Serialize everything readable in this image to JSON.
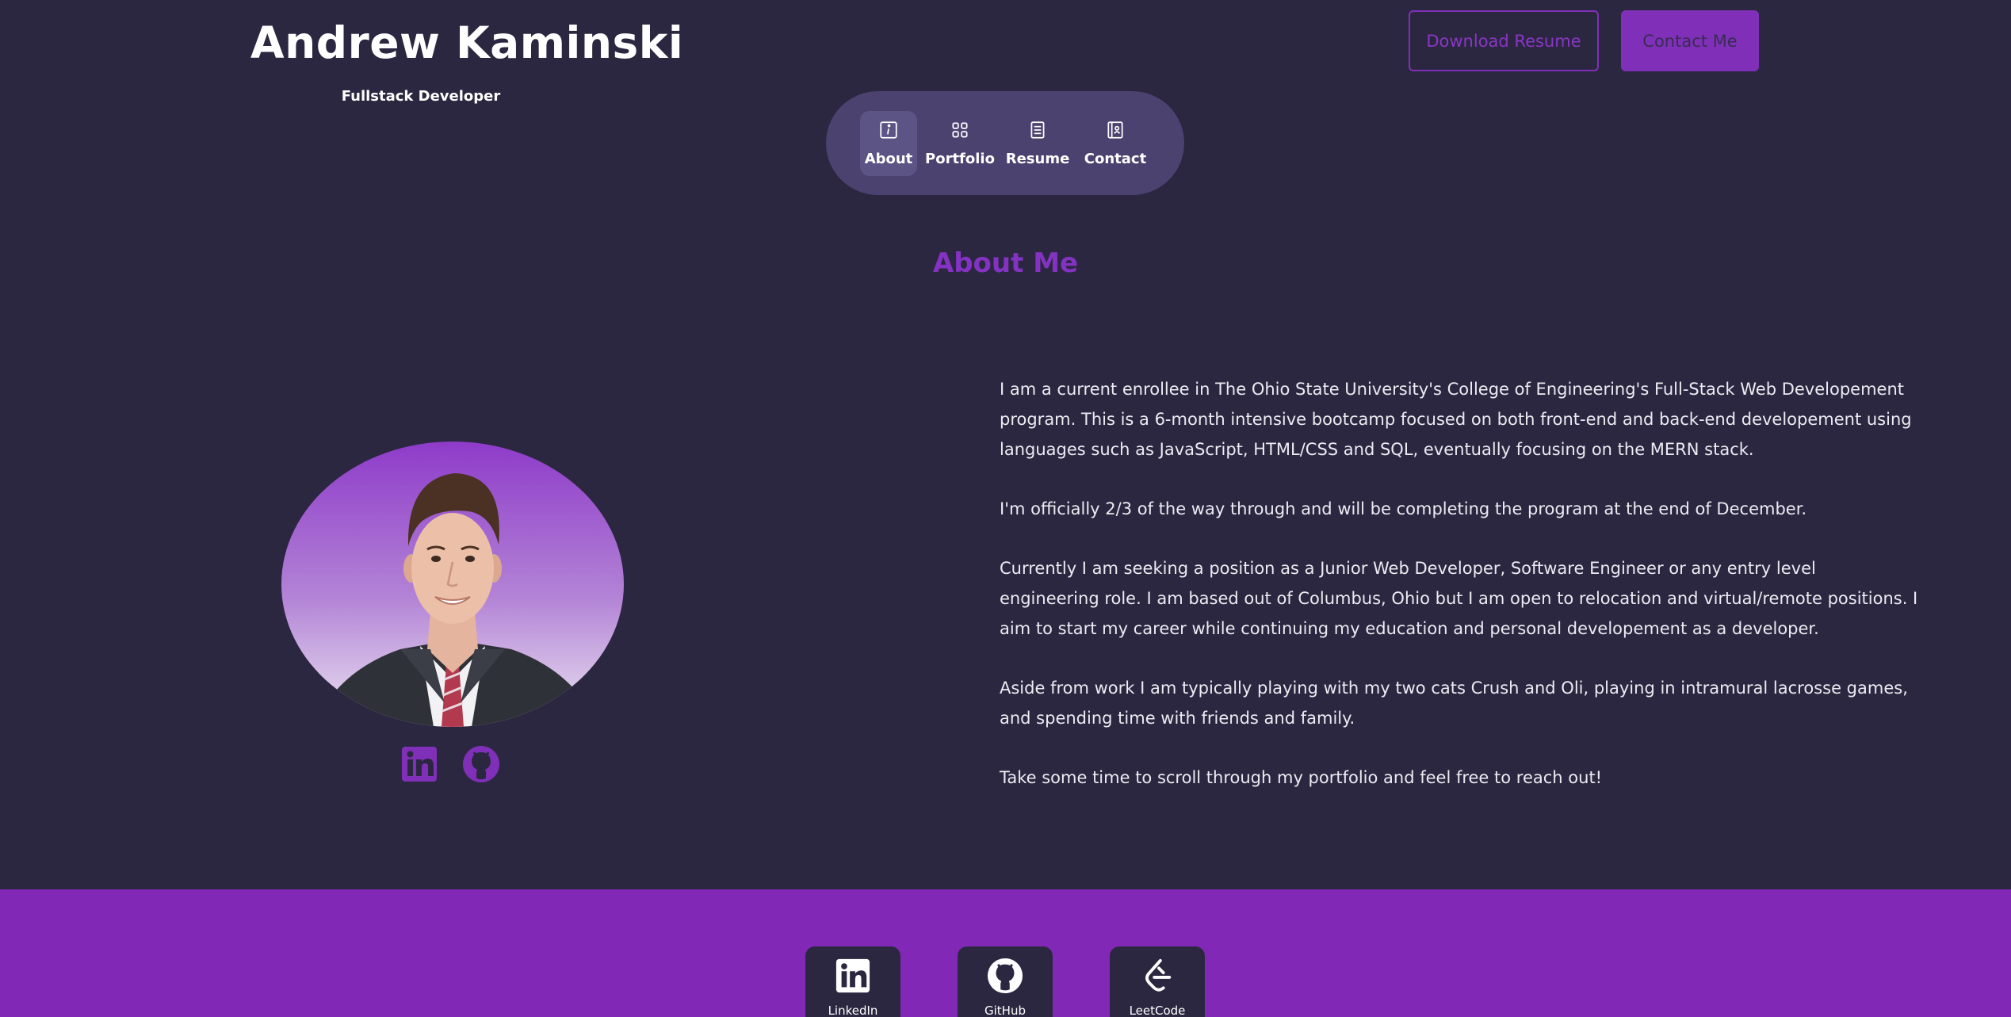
{
  "header": {
    "name": "Andrew Kaminski",
    "role": "Fullstack Developer",
    "download_resume": "Download Resume",
    "contact_me": "Contact Me"
  },
  "nav": {
    "items": [
      {
        "label": "About",
        "icon": "info-icon",
        "active": true
      },
      {
        "label": "Portfolio",
        "icon": "grid-icon",
        "active": false
      },
      {
        "label": "Resume",
        "icon": "document-icon",
        "active": false
      },
      {
        "label": "Contact",
        "icon": "contact-book-icon",
        "active": false
      }
    ]
  },
  "about": {
    "title": "About Me",
    "paragraphs": [
      "I am a current enrollee in The Ohio State University's College of Engineering's Full-Stack Web Developement program. This is a 6-month intensive bootcamp focused on both front-end and back-end developement using languages such as JavaScript, HTML/CSS and SQL, eventually focusing on the MERN stack.",
      "I'm officially 2/3 of the way through and will be completing the program at the end of December.",
      "Currently I am seeking a position as a Junior Web Developer, Software Engineer or any entry level engineering role. I am based out of Columbus, Ohio but I am open to relocation and virtual/remote positions. I aim to start my career while continuing my education and personal developement as a developer.",
      "Aside from work I am typically playing with my two cats Crush and Oli, playing in intramural lacrosse games, and spending time with friends and family.",
      "Take some time to scroll through my portfolio and feel free to reach out!"
    ],
    "socials": [
      {
        "icon": "linkedin-icon"
      },
      {
        "icon": "github-icon"
      }
    ]
  },
  "footer": {
    "links": [
      {
        "label": "LinkedIn",
        "icon": "linkedin-icon"
      },
      {
        "label": "GitHub",
        "icon": "github-icon"
      },
      {
        "label": "LeetCode",
        "icon": "leetcode-icon"
      }
    ]
  },
  "colors": {
    "background": "#2b2740",
    "accent": "#8030b8",
    "nav_bg": "#4b4270",
    "footer_bg": "#8129b6"
  }
}
